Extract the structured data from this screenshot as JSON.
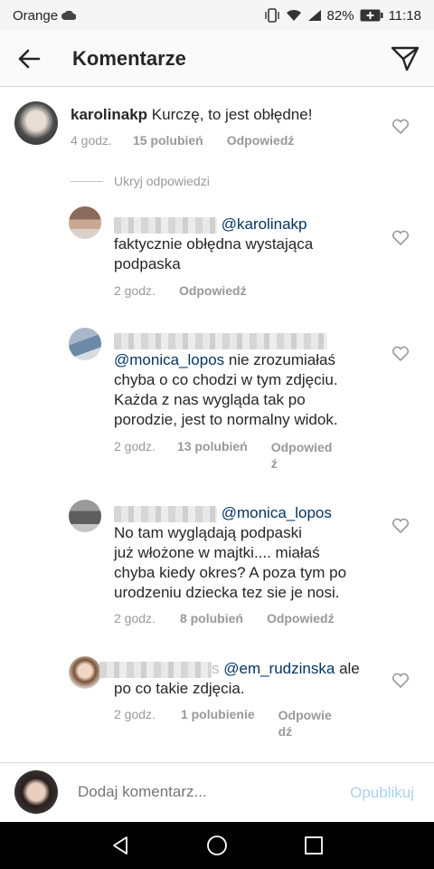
{
  "status": {
    "carrier": "Orange",
    "battery": "82%",
    "time": "11:18"
  },
  "header": {
    "title": "Komentarze"
  },
  "main_comment": {
    "username": "karolinakp",
    "text": "Kurczę, to jest obłędne!",
    "time": "4 godz.",
    "likes": "15 polubień",
    "reply": "Odpowiedź"
  },
  "hide_replies": "Ukryj odpowiedzi",
  "replies": [
    {
      "mention": "@karolinakp",
      "text_line1": "faktycznie obłędna wystająca",
      "text_line2": "podpaska",
      "time": "2 godz.",
      "reply": "Odpowiedź"
    },
    {
      "mention": "@monica_lopos",
      "text_first": "nie zrozumiałaś",
      "text_line2": "chyba o co chodzi w tym zdjęciu.",
      "text_line3": "Każda z nas wygląda tak po",
      "text_line4": "porodzie, jest to normalny widok.",
      "time": "2 godz.",
      "likes": "13 polubień",
      "reply_line1": "Odpowied",
      "reply_line2": "ź"
    },
    {
      "mention": "@monica_lopos",
      "text_line1": "No tam wyglądają podpaski",
      "text_line2": "już włożone w majtki.... miałaś",
      "text_line3": "chyba kiedy okres? A poza tym po",
      "text_line4": "urodzeniu dziecka tez sie je nosi.",
      "time": "2 godz.",
      "likes": "8 polubień",
      "reply": "Odpowiedź"
    },
    {
      "visible_name_fragment": "s",
      "mention": "@em_rudzinska",
      "text_after": "ale",
      "text_line2": "po co takie zdjęcia.",
      "time": "2 godz.",
      "likes": "1 polubienie",
      "reply_line1": "Odpowie",
      "reply_line2": "dź"
    }
  ],
  "composer": {
    "placeholder": "Dodaj komentarz...",
    "publish": "Opublikuj"
  },
  "colors": {
    "mention": "#003569",
    "meta": "#999999",
    "publish_disabled": "#a8d3f5"
  }
}
